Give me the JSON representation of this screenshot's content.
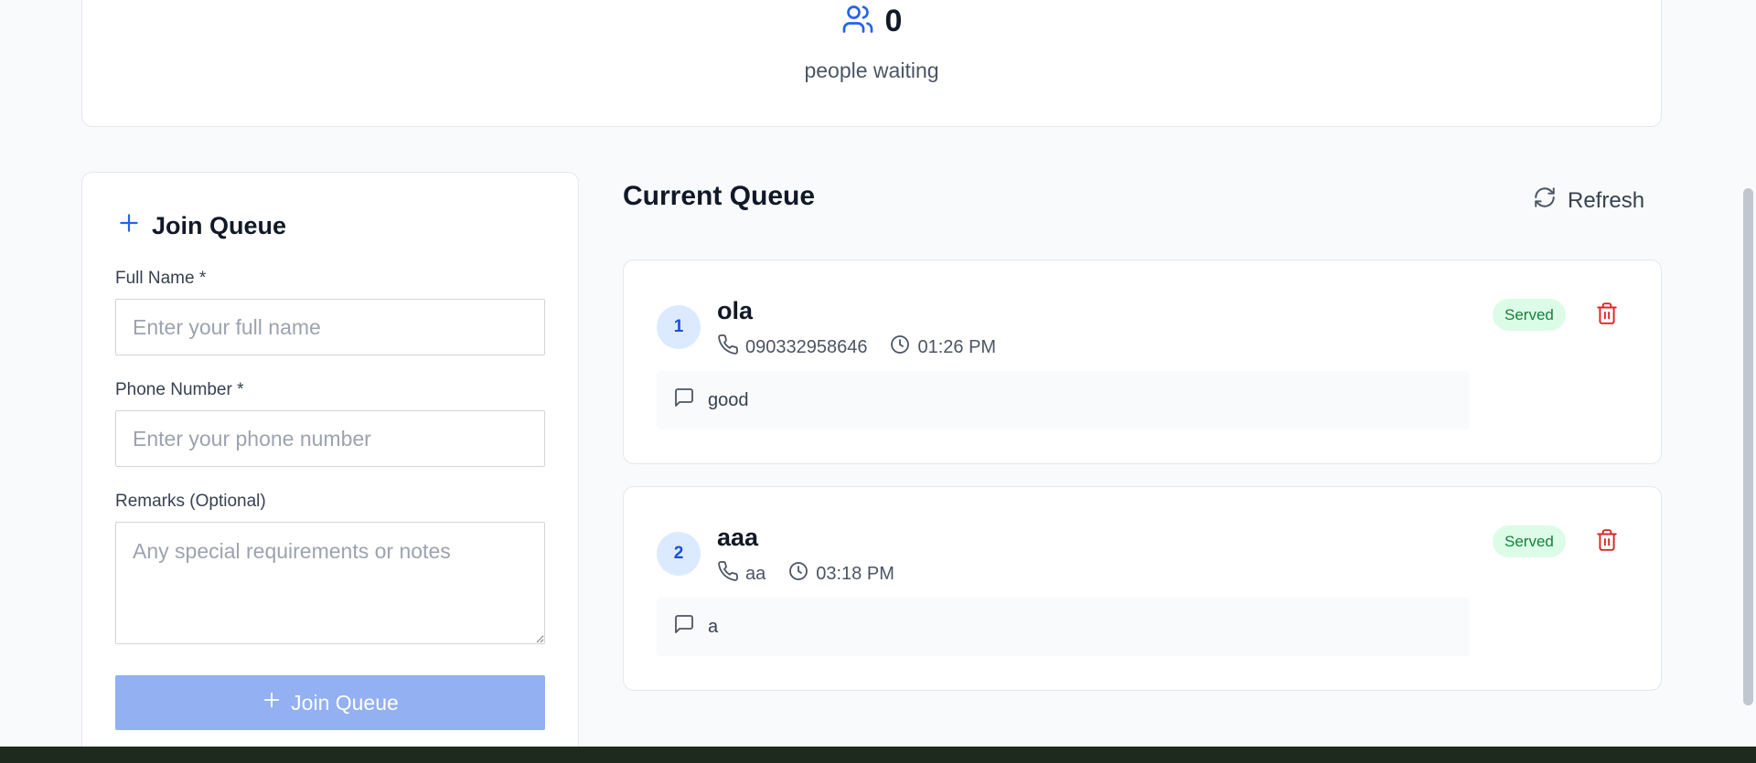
{
  "stats": {
    "count": "0",
    "label": "people waiting"
  },
  "join_form": {
    "title": "Join Queue",
    "full_name_label": "Full Name *",
    "full_name_placeholder": "Enter your full name",
    "phone_label": "Phone Number *",
    "phone_placeholder": "Enter your phone number",
    "remarks_label": "Remarks (Optional)",
    "remarks_placeholder": "Any special requirements or notes",
    "submit_label": "Join Queue"
  },
  "queue": {
    "title": "Current Queue",
    "refresh_label": "Refresh",
    "entries": [
      {
        "position": "1",
        "name": "ola",
        "phone": "090332958646",
        "time": "01:26 PM",
        "remark": "good",
        "status": "Served"
      },
      {
        "position": "2",
        "name": "aaa",
        "phone": "aa",
        "time": "03:18 PM",
        "remark": "a",
        "status": "Served"
      }
    ]
  },
  "colors": {
    "accent": "#2563eb",
    "served_bg": "#dcfce7",
    "served_text": "#15803d",
    "delete": "#dc2626",
    "button_disabled": "#93b0f2"
  }
}
